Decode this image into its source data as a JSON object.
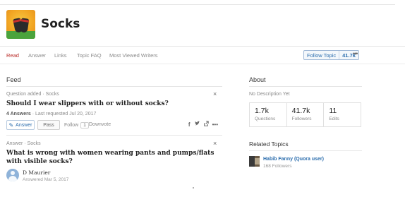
{
  "topic": {
    "title": "Socks"
  },
  "tabs": [
    {
      "label": "Read",
      "active": true
    },
    {
      "label": "Answer",
      "active": false
    },
    {
      "label": "Links",
      "active": false
    },
    {
      "label": "Topic FAQ",
      "active": false
    },
    {
      "label": "Most Viewed Writers",
      "active": false
    }
  ],
  "follow": {
    "label": "Follow Topic",
    "count": "41.7k"
  },
  "more_label": "•••",
  "feed": {
    "title": "Feed",
    "card1": {
      "meta": "Question added · Socks",
      "title": "Should I wear slippers with or without socks?",
      "answers": "4 Answers",
      "requested": " · Last requested Jul 20, 2017",
      "answer_label": "Answer",
      "pass_label": "Pass",
      "follow_label": "Follow",
      "follow_count": "1",
      "downvote_label": "Downvote",
      "more_label": "•••"
    },
    "card2": {
      "meta": "Answer · Socks",
      "title": "What is wrong with women wearing pants and pumps/flats with visible socks?",
      "author": "D Maurier",
      "answered": "Answered Mar 5, 2017"
    },
    "close_label": "×"
  },
  "about": {
    "title": "About",
    "description": "No Description Yet",
    "stats": [
      {
        "num": "1.7k",
        "label": "Questions"
      },
      {
        "num": "41.7k",
        "label": "Followers"
      },
      {
        "num": "11",
        "label": "Edits"
      }
    ]
  },
  "related": {
    "title": "Related Topics",
    "items": [
      {
        "name": "Habib Fanny (Quora user)",
        "followers": "168 Followers"
      }
    ]
  },
  "icons": [
    "socks-topic-image",
    "pencil-icon",
    "facebook-icon",
    "twitter-icon",
    "share-icon",
    "close-icon",
    "avatar-icon"
  ],
  "colors": {
    "brand_red": "#b92b27",
    "link_blue": "#2b6dad"
  }
}
